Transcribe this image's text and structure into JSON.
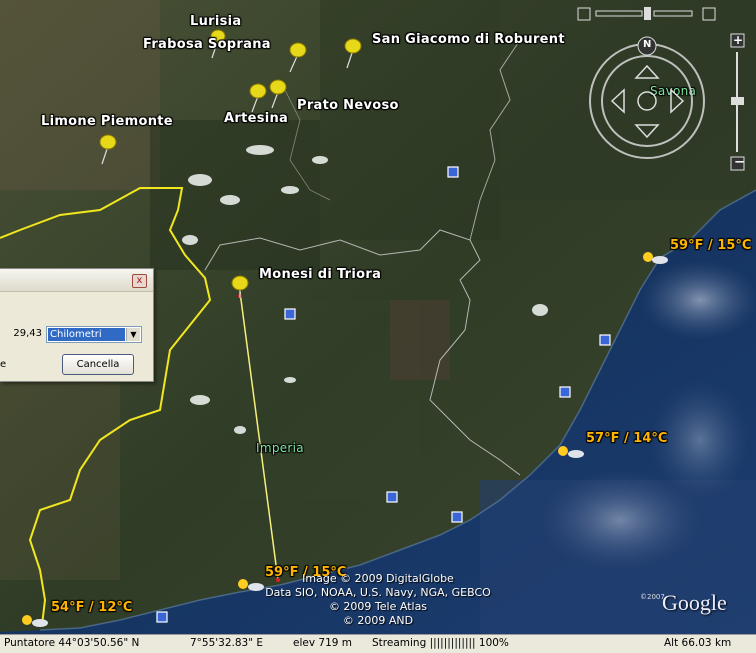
{
  "places": {
    "lurisia": "Lurisia",
    "frabosa": "Frabosa Soprana",
    "san_giacomo": "San Giacomo di Roburent",
    "artesina": "Artesina",
    "prato_nevoso": "Prato Nevoso",
    "limone": "Limone Piemonte",
    "monesi": "Monesi di Triora",
    "imperia": "Imperia",
    "savona": "Savona"
  },
  "weather": {
    "w1": "59°F / 15°C",
    "w2": "57°F / 14°C",
    "w3": "59°F / 15°C",
    "w4": "54°F / 12°C"
  },
  "credits": {
    "line1": "Image © 2009 DigitalGlobe",
    "line2": "Data SIO, NOAA, U.S. Navy, NGA, GEBCO",
    "line3": "© 2009 Tele Atlas",
    "line4": "© 2009 AND",
    "google": "Google",
    "google_small": "©2007"
  },
  "compass": {
    "north": "N"
  },
  "dialog": {
    "close": "x",
    "value": "29,43",
    "unit": "Chilometri",
    "left_text": "e",
    "cancel": "Cancella"
  },
  "status": {
    "pointer": "Puntatore  44°03'50.56\" N",
    "lon": "7°55'32.83\" E",
    "elev": "elev   719 m",
    "streaming": "Streaming ||||||||||||| 100%",
    "alt": "Alt    66.03 km"
  },
  "colors": {
    "border_line": "#f2e71e",
    "measure_line": "#f6f07a",
    "weather_text": "#ffb400"
  }
}
